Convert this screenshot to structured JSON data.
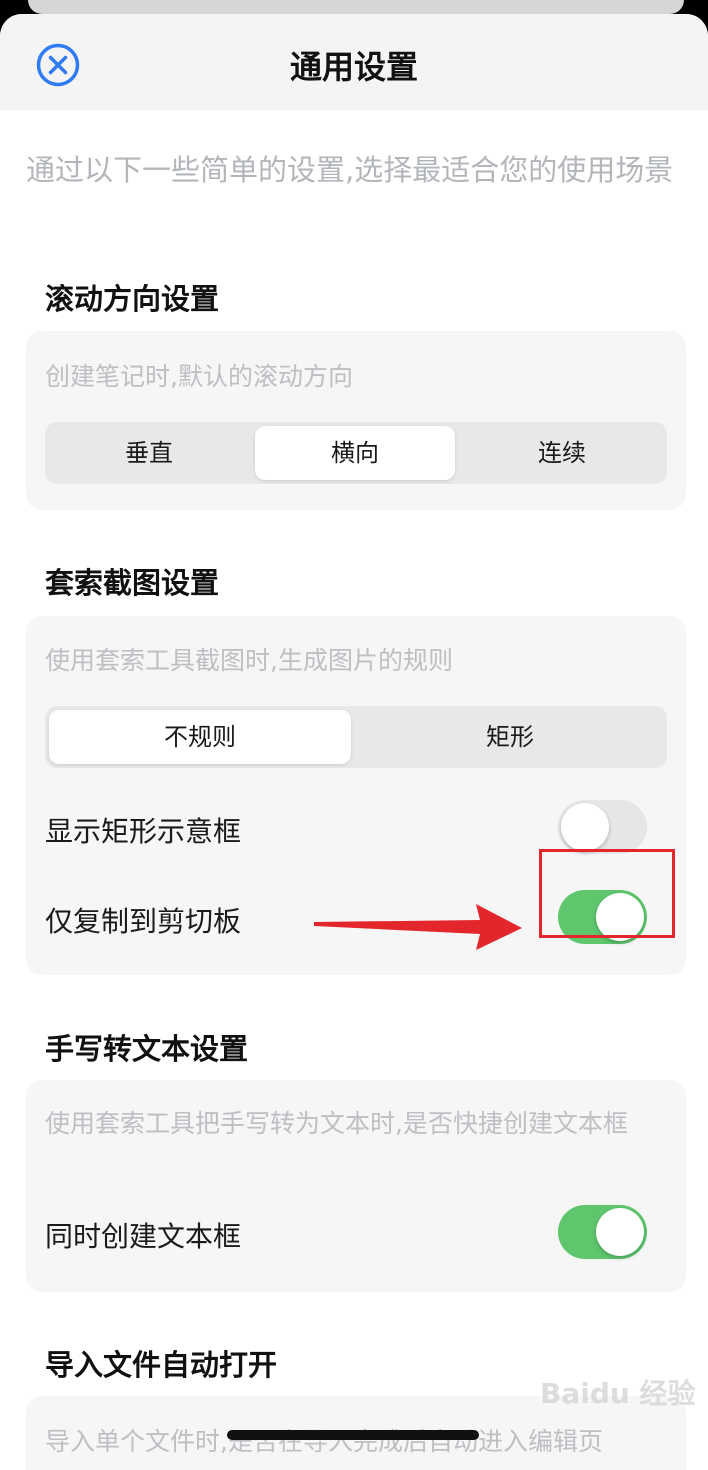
{
  "header": {
    "title": "通用设置",
    "close_icon": "close-circle-icon"
  },
  "intro_text": "通过以下一些简单的设置,选择最适合您的使用场景",
  "sections": [
    {
      "title": "滚动方向设置",
      "description": "创建笔记时,默认的滚动方向",
      "options": [
        "垂直",
        "横向",
        "连续"
      ],
      "selected": "横向"
    },
    {
      "title": "套索截图设置",
      "description": "使用套索工具截图时,生成图片的规则",
      "options": [
        "不规则",
        "矩形"
      ],
      "selected": "不规则",
      "toggles": [
        {
          "label": "显示矩形示意框",
          "on": false
        },
        {
          "label": "仅复制到剪切板",
          "on": true
        }
      ]
    },
    {
      "title": "手写转文本设置",
      "description": "使用套索工具把手写转为文本时,是否快捷创建文本框",
      "toggles": [
        {
          "label": "同时创建文本框",
          "on": true
        }
      ]
    },
    {
      "title": "导入文件自动打开",
      "description": "导入单个文件时,是否在导入完成后自动进入编辑页"
    }
  ],
  "watermark": "Baidu 经验",
  "colors": {
    "accent_blue": "#2f7bf5",
    "toggle_on": "#5fc66e",
    "annotation_red": "#e3262b"
  }
}
